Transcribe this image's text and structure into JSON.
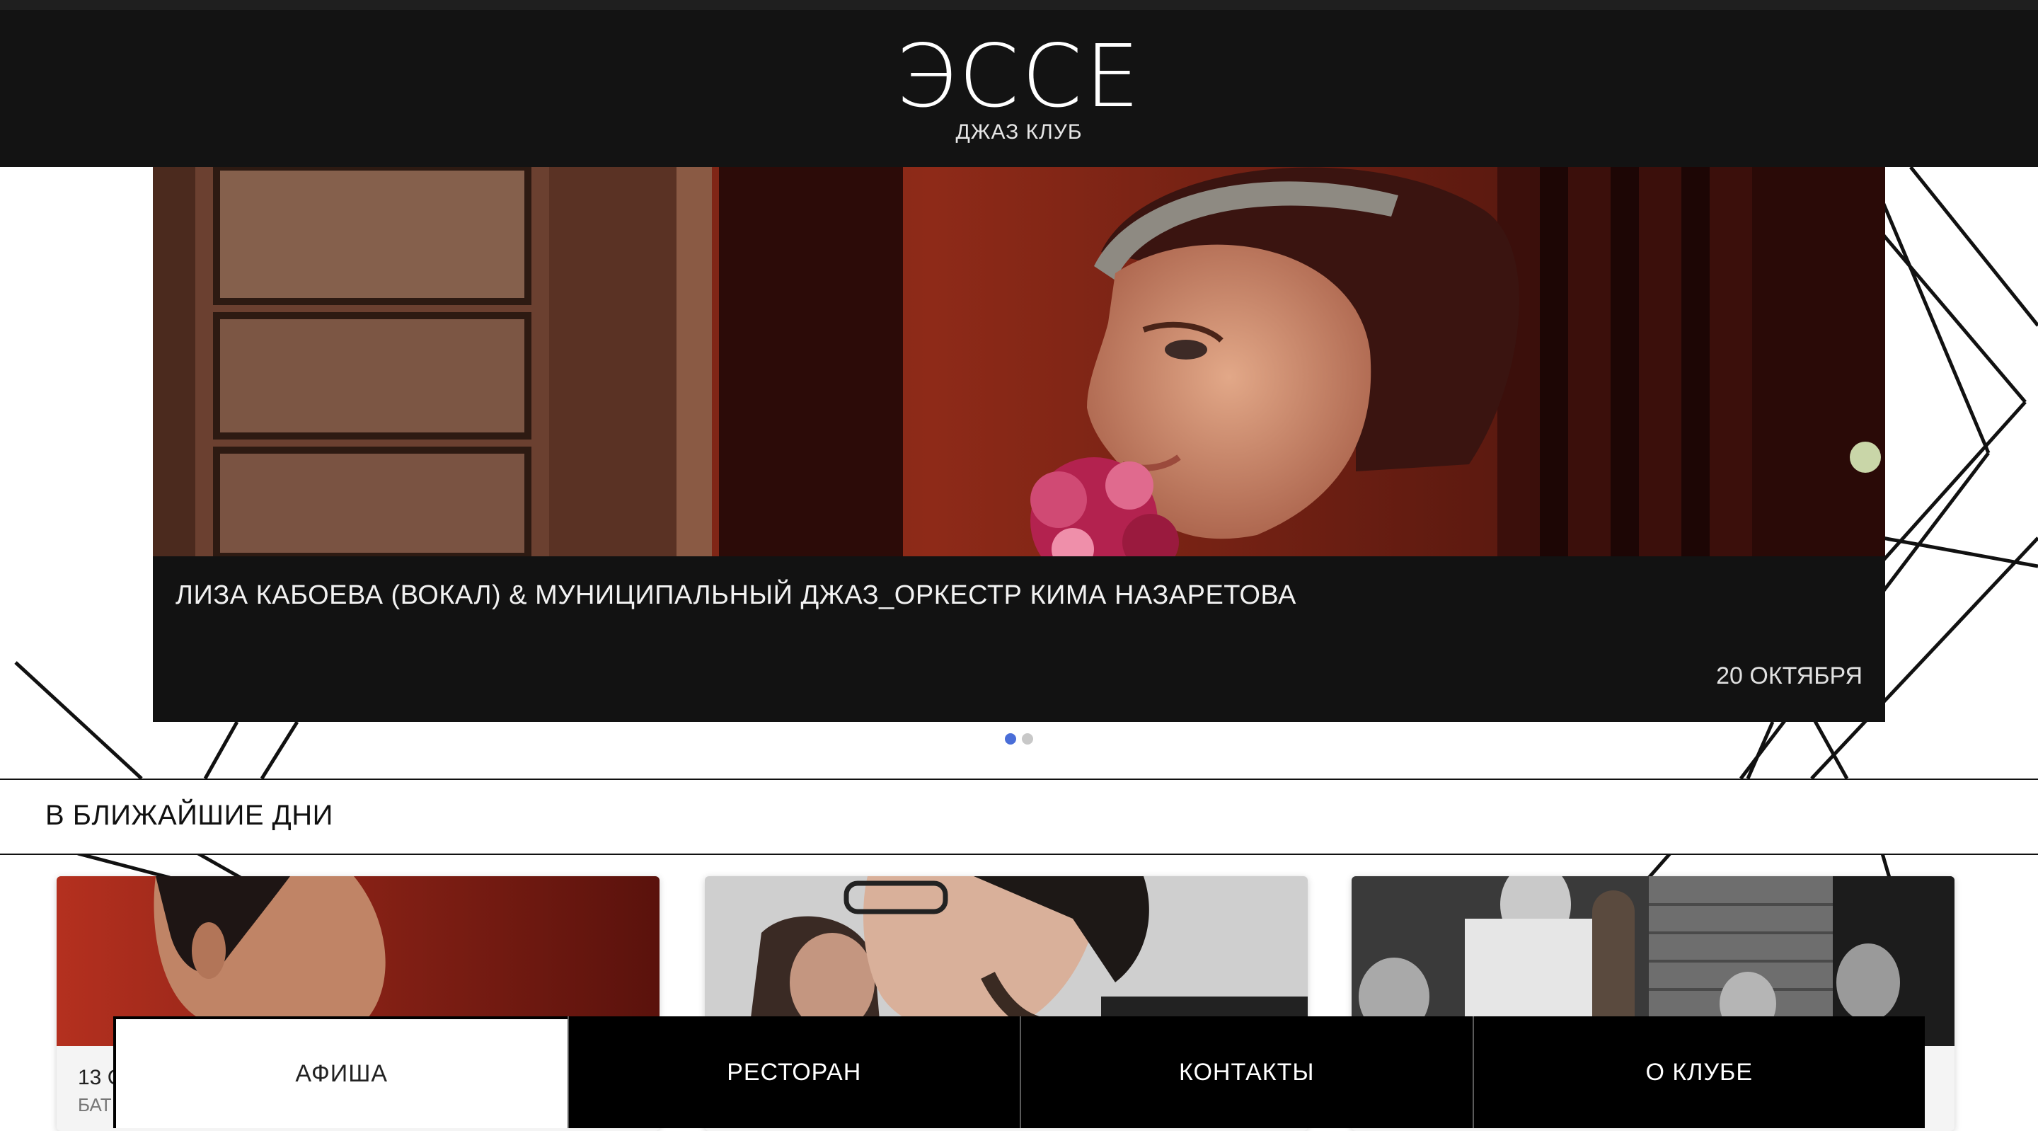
{
  "club": {
    "name": "ЭССЕ",
    "subtitle": "ДЖАЗ КЛУБ"
  },
  "slider": {
    "title": "ЛИЗА КАБОЕВА (ВОКАЛ) & МУНИЦИПАЛЬНЫЙ ДЖАЗ_ОРКЕСТР КИМА НАЗАРЕТОВА",
    "date": "20 ОКТЯБРЯ",
    "slide_count": 2,
    "active_slide": 1
  },
  "upcoming": {
    "title": "В БЛИЖАЙШИЕ ДНИ",
    "cards": [
      {
        "date": "13 С",
        "subtitle": "БАТ"
      },
      {
        "date": "",
        "subtitle": ""
      },
      {
        "date": "",
        "subtitle": ""
      }
    ]
  },
  "nav": {
    "items": [
      {
        "label": "АФИША",
        "active": true
      },
      {
        "label": "РЕСТОРАН",
        "active": false
      },
      {
        "label": "КОНТАКТЫ",
        "active": false
      },
      {
        "label": "О КЛУБЕ",
        "active": false
      }
    ]
  },
  "colors": {
    "header_bg": "#131313",
    "caption_bg": "#121212",
    "dot_active": "#4a6ed8",
    "dot_inactive": "#c8c8c8",
    "nav_bg": "#000000"
  }
}
